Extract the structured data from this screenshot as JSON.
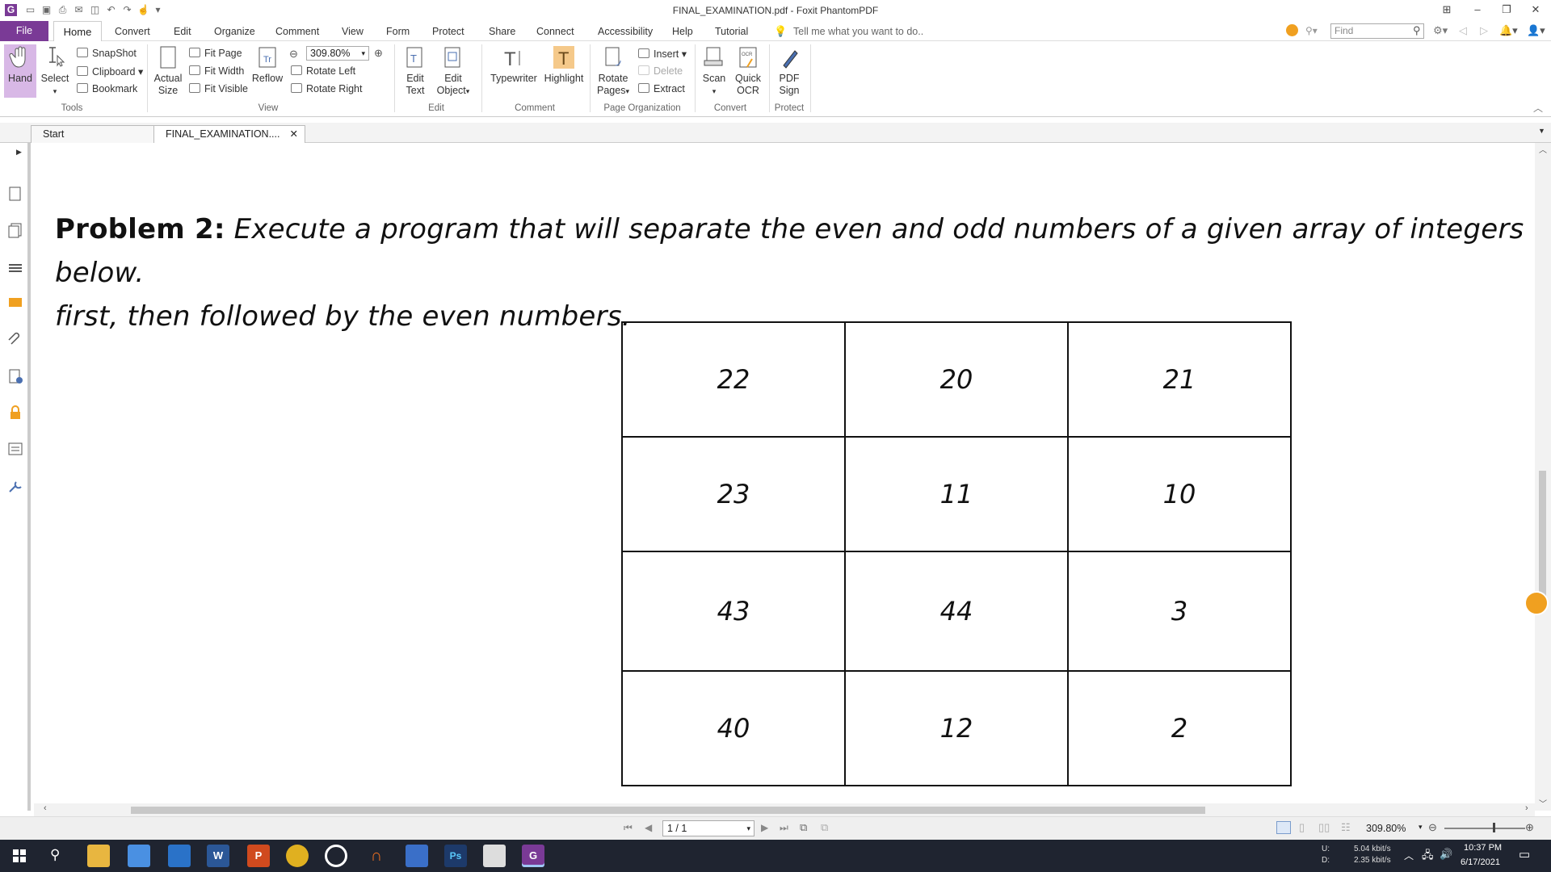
{
  "window": {
    "title": "FINAL_EXAMINATION.pdf - Foxit PhantomPDF"
  },
  "menu": {
    "file": "File",
    "home": "Home",
    "items": [
      "Convert",
      "Edit",
      "Organize",
      "Comment",
      "View",
      "Form",
      "Protect",
      "Share",
      "Connect",
      "Accessibility",
      "Help",
      "Tutorial"
    ],
    "tell_me": "Tell me what you want to do..",
    "find_placeholder": "Find"
  },
  "ribbon": {
    "hand": "Hand",
    "select": "Select",
    "snapshot": "SnapShot",
    "clipboard": "Clipboard",
    "bookmark": "Bookmark",
    "actual": "Actual",
    "size": "Size",
    "fit_page": "Fit Page",
    "fit_width": "Fit Width",
    "fit_visible": "Fit Visible",
    "reflow": "Reflow",
    "zoom_value": "309.80%",
    "rotate_left": "Rotate Left",
    "rotate_right": "Rotate Right",
    "edit": "Edit",
    "text": "Text",
    "object": "Object",
    "typewriter": "Typewriter",
    "highlight": "Highlight",
    "rotate": "Rotate",
    "pages": "Pages",
    "insert": "Insert",
    "delete": "Delete",
    "extract": "Extract",
    "scan": "Scan",
    "quick": "Quick",
    "ocr": "OCR",
    "pdf": "PDF",
    "sign": "Sign",
    "groups": {
      "tools": "Tools",
      "view": "View",
      "edit": "Edit",
      "comment": "Comment",
      "page_org": "Page Organization",
      "convert": "Convert",
      "protect": "Protect"
    }
  },
  "tabs": {
    "start": "Start",
    "doc": "FINAL_EXAMINATION...."
  },
  "document": {
    "problem_label": "Problem 2:",
    "problem_line1": "Execute a program that will separate the even and odd numbers of a given array of integers below.",
    "problem_line2": "first, then followed by the even numbers.",
    "table": [
      [
        "22",
        "20",
        "21"
      ],
      [
        "23",
        "11",
        "10"
      ],
      [
        "43",
        "44",
        "3"
      ],
      [
        "40",
        "12",
        "2"
      ]
    ]
  },
  "status": {
    "page": "1 / 1",
    "zoom": "309.80%"
  },
  "taskbar": {
    "net_u_label": "U:",
    "net_d_label": "D:",
    "net_u": "5.04 kbit/s",
    "net_d": "2.35 kbit/s",
    "time": "10:37 PM",
    "date": "6/17/2021"
  },
  "colors": {
    "accent": "#7a3a96",
    "highlight_bg": "#f5c98a",
    "hand_bg": "#d8b8e6",
    "taskbar": "#1f2430"
  }
}
